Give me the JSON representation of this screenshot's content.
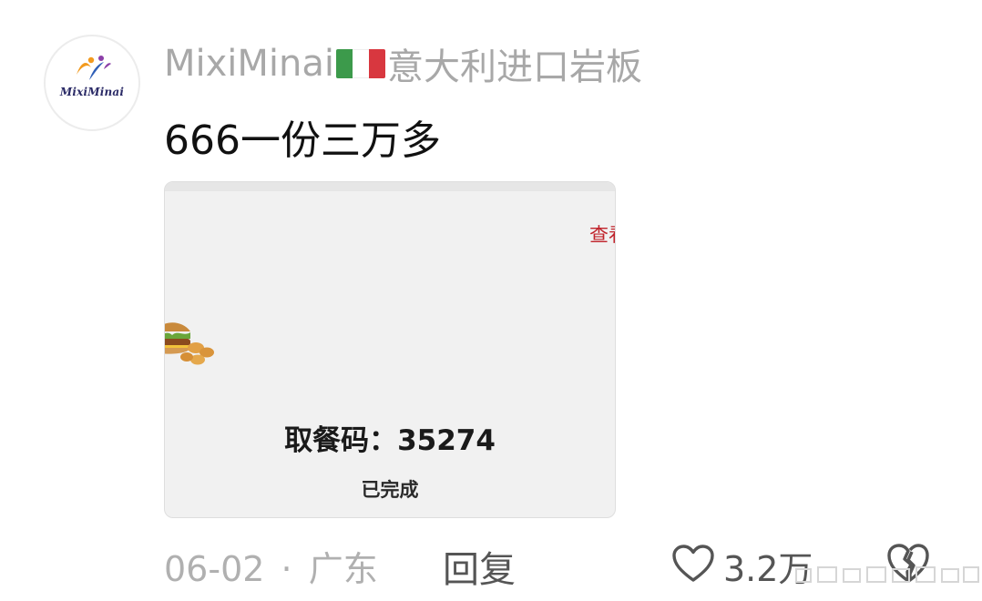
{
  "avatar": {
    "name": "MixiMinai",
    "colors": {
      "mark_orange": "#f29a1e",
      "mark_blue": "#2f5fb7",
      "mark_purple": "#8c3fa8",
      "name_color": "#2a2a66"
    }
  },
  "comment": {
    "username_prefix": "MixiMinai",
    "username_flag": "italy-flag-icon",
    "username_suffix": "意大利进口岩板",
    "text": "666一份三万多",
    "date": "06-02",
    "separator": "·",
    "location": "广东",
    "reply_label": "回复",
    "like_count": "3.2万",
    "like_icon": "heart-outline-icon",
    "dislike_icon": "broken-heart-outline-icon"
  },
  "attached_image": {
    "view_link": "查看",
    "pickup_code_label": "取餐码：",
    "pickup_code": "35274",
    "status": "已完成",
    "food_icon": "burger-icon",
    "accent": "#c0222a"
  },
  "colors": {
    "username": "#a8a8a8",
    "comment_text": "#111111",
    "meta_text": "#b0b0b0",
    "action_text": "#555555",
    "flag": [
      "#3c9a4b",
      "#ffffff",
      "#d8373f"
    ]
  }
}
